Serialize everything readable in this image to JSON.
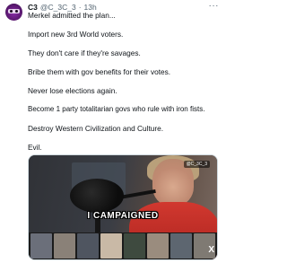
{
  "tweet": {
    "author_name": "C3",
    "handle": "@C_3C_3",
    "separator": "·",
    "time": "13h",
    "more_label": "···",
    "lines": [
      "Merkel admitted the plan...",
      "Import new 3rd World voters.",
      "They don't care if they're savages.",
      "Bribe them with gov benefits for their votes.",
      "Never lose elections again.",
      "Become 1 party totalitarian govs who rule with iron fists.",
      "Destroy Western Civilization and Culture.",
      "Evil."
    ],
    "media": {
      "badge": "@C_3C_3",
      "caption": "I CAMPAIGNED",
      "corner_logo": "X",
      "thumbnail_colors": [
        "#6b6f7a",
        "#8a8178",
        "#4f5560",
        "#c9b9a6",
        "#3e4a3f",
        "#9a8c7e",
        "#5d6670",
        "#7f7a73"
      ]
    }
  }
}
